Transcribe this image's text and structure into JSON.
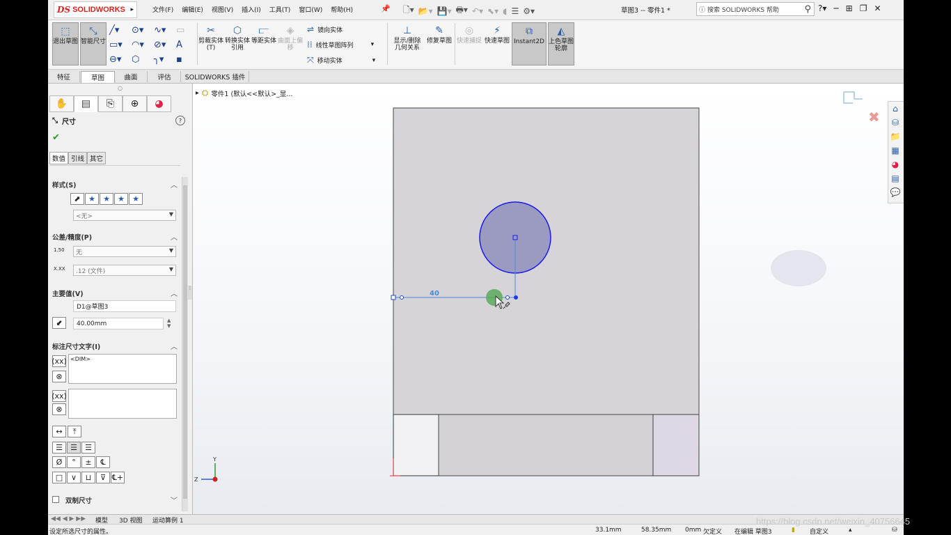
{
  "app": {
    "brand_ds": "DS",
    "brand": "SOLIDWORKS",
    "doc_title": "草图3 -- 零件1 *",
    "search_placeholder": "搜索 SOLIDWORKS 帮助"
  },
  "menu": [
    "文件(F)",
    "编辑(E)",
    "视图(V)",
    "插入(I)",
    "工具(T)",
    "窗口(W)",
    "帮助(H)"
  ],
  "ribbon": {
    "exit_sketch": "退出草图",
    "smart_dim": "智能尺寸",
    "trim": "剪裁实体(T)",
    "convert": "转换实体引用",
    "offset": "等距实体",
    "surface_offset": "曲面上偏移",
    "mirror": "镜向实体",
    "linear_pattern": "线性草图阵列",
    "move": "移动实体",
    "show_relations": "显示/删除几何关系",
    "repair": "修复草图",
    "quick_snap": "快速捕捉",
    "rapid_sketch": "快速草图",
    "instant2d": "Instant2D",
    "shaded_sketch": "上色草图轮廓"
  },
  "tabs": [
    "特征",
    "草图",
    "曲面",
    "评估",
    "SOLIDWORKS 插件"
  ],
  "active_tab": "草图",
  "panel": {
    "title": "尺寸",
    "help": "?",
    "subtabs": [
      "数值",
      "引线",
      "其它"
    ],
    "style_section": "样式(S)",
    "style_value": "<无>",
    "tolerance_section": "公差/精度(P)",
    "tolerance_value": "无",
    "precision_value": ".12 (文件)",
    "primary_section": "主要值(V)",
    "primary_name": "D1@草图3",
    "primary_value": "40.00mm",
    "dimtext_section": "标注尺寸文字(I)",
    "dimtext_value": "<DIM>",
    "dual_dim": "双制尺寸"
  },
  "tree": {
    "root": "零件1 (默认<<默认>_显..."
  },
  "dimension_label": "40",
  "bottom_tabs": [
    "模型",
    "3D 视图",
    "运动算例 1"
  ],
  "status": {
    "hint": "设定所选尺寸的属性。",
    "x": "33.1mm",
    "y": "58.35mm",
    "z": "0mm",
    "state": "欠定义",
    "editing": "在编辑 草图3",
    "units": "自定义",
    "watermark": "https://blog.csdn.net/weixin_40756645"
  },
  "colors": {
    "accent": "#2a5ea8",
    "circle_fill": "#9b9bc2",
    "circle_stroke": "#1a1aee",
    "dim_line": "#4a8ad8",
    "part_face": "#d6d4d8",
    "brand_red": "#dd2222"
  }
}
